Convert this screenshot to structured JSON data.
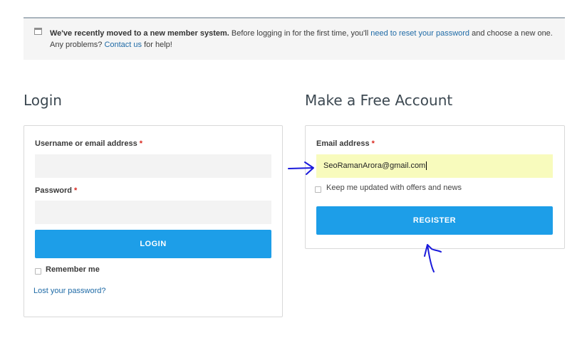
{
  "notice": {
    "icon": "window-icon",
    "bold_text": "We've recently moved to a new member system.",
    "text_1": " Before logging in for the first time, you'll ",
    "reset_link": "need to reset your password",
    "text_2": " and choose a new one. Any problems? ",
    "contact_link": "Contact us",
    "text_3": " for help!"
  },
  "login": {
    "heading": "Login",
    "username_label": "Username or email address",
    "required_mark": "*",
    "username_value": "",
    "password_label": "Password",
    "password_value": "",
    "login_button": "LOGIN",
    "remember_label": "Remember me",
    "lost_password_link": "Lost your password?"
  },
  "register": {
    "heading": "Make a Free Account",
    "email_label": "Email address",
    "required_mark": "*",
    "email_value": "SeoRamanArora@gmail.com",
    "updates_label": "Keep me updated with offers and news",
    "register_button": "REGISTER"
  },
  "colors": {
    "accent": "#1d9ee8",
    "link": "#1e6aa6",
    "required": "#d9281f",
    "filled_field": "#f8fbbd",
    "annotation": "#1a1adb"
  }
}
